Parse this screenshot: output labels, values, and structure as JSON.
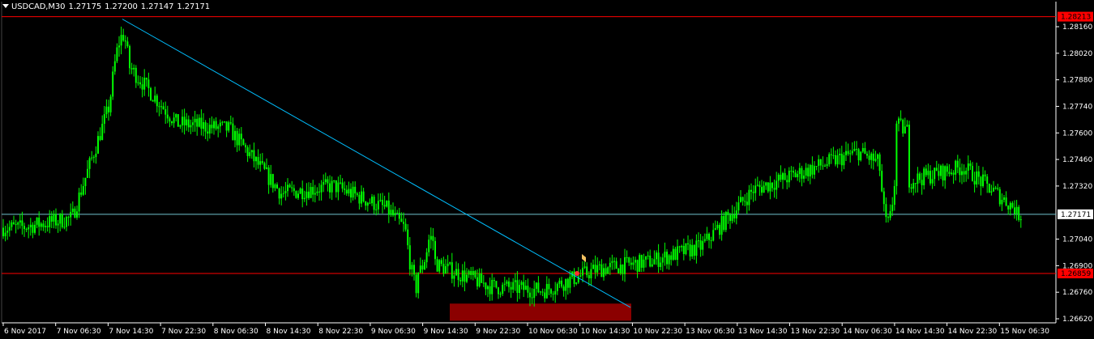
{
  "symbol_header": {
    "symbol": "USDCAD,",
    "timeframe": "M30",
    "open": "1.27175",
    "high": "1.27200",
    "low": "1.27147",
    "close": "1.27171"
  },
  "colors": {
    "background": "#000000",
    "axis": "#FFFFFF",
    "candle": "#00FF00",
    "bid_line": "#6FC3CE",
    "trendline": "#00BFFF",
    "level_line": "#FF0000",
    "zone": "#8B0000",
    "level_label_bg": "#FF0000",
    "bid_label_bg": "#FFFFFF",
    "arrow_marker": "#F0C060",
    "stop_marker": "#FF3030"
  },
  "price_scale": {
    "ticks": [
      "1.28160",
      "1.28020",
      "1.27880",
      "1.27740",
      "1.27600",
      "1.27460",
      "1.27320",
      "1.27040",
      "1.26900",
      "1.26760",
      "1.26620"
    ],
    "tick_values": [
      1.2816,
      1.2802,
      1.2788,
      1.2774,
      1.276,
      1.2746,
      1.2732,
      1.2704,
      1.269,
      1.2676,
      1.2662
    ],
    "bid_label": "1.27171",
    "bid_value": 1.27171,
    "levels": [
      {
        "label": "1.28213",
        "value": 1.28213
      },
      {
        "label": "1.26859",
        "value": 1.26859
      }
    ]
  },
  "time_scale": {
    "labels": [
      "6 Nov 2017",
      "7 Nov 06:30",
      "7 Nov 14:30",
      "7 Nov 22:30",
      "8 Nov 06:30",
      "8 Nov 14:30",
      "8 Nov 22:30",
      "9 Nov 06:30",
      "9 Nov 14:30",
      "9 Nov 22:30",
      "10 Nov 06:30",
      "10 Nov 14:30",
      "10 Nov 22:30",
      "13 Nov 06:30",
      "13 Nov 14:30",
      "13 Nov 22:30",
      "14 Nov 06:30",
      "14 Nov 14:30",
      "14 Nov 22:30",
      "15 Nov 06:30"
    ]
  },
  "chart_data": {
    "type": "candlestick",
    "symbol": "USDCAD",
    "timeframe": "M30",
    "ylim": [
      1.2658,
      1.2826
    ],
    "approx_close_path": [
      {
        "x": "6 Nov 2017",
        "y": 1.271
      },
      {
        "x": "7 Nov 06:30",
        "y": 1.2715
      },
      {
        "x": "7 Nov 14:30",
        "y": 1.2798
      },
      {
        "x": "7 Nov 22:30",
        "y": 1.2765
      },
      {
        "x": "8 Nov 06:30",
        "y": 1.2762
      },
      {
        "x": "8 Nov 14:30",
        "y": 1.2728
      },
      {
        "x": "8 Nov 22:30",
        "y": 1.2732
      },
      {
        "x": "9 Nov 06:30",
        "y": 1.272
      },
      {
        "x": "9 Nov 14:30",
        "y": 1.269
      },
      {
        "x": "9 Nov 22:30",
        "y": 1.2679
      },
      {
        "x": "10 Nov 06:30",
        "y": 1.2677
      },
      {
        "x": "10 Nov 14:30",
        "y": 1.2688
      },
      {
        "x": "10 Nov 22:30",
        "y": 1.2692
      },
      {
        "x": "13 Nov 06:30",
        "y": 1.27
      },
      {
        "x": "13 Nov 14:30",
        "y": 1.273
      },
      {
        "x": "13 Nov 22:30",
        "y": 1.274
      },
      {
        "x": "14 Nov 06:30",
        "y": 1.275
      },
      {
        "x": "14 Nov 14:30",
        "y": 1.2735
      },
      {
        "x": "14 Nov 22:30",
        "y": 1.2742
      },
      {
        "x": "15 Nov 06:30",
        "y": 1.272
      }
    ],
    "last_close": 1.27171,
    "trendline": {
      "from_y": 1.282,
      "to_y": 1.2668
    },
    "demand_zone": {
      "from_y": 1.2661,
      "to_y": 1.267
    },
    "grid": false
  }
}
